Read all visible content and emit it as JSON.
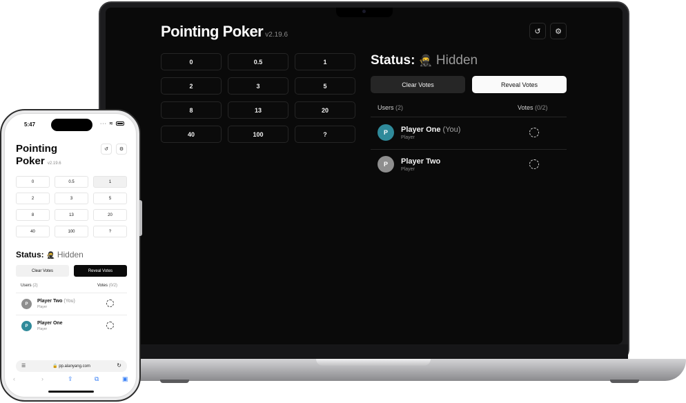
{
  "colors": {
    "avatar_teal": "#2f8a9a",
    "avatar_gray": "#8e8e8e"
  },
  "app": {
    "title": "Pointing Poker",
    "title_line1": "Pointing",
    "title_line2": "Poker",
    "version": "v2.19.6",
    "cards": [
      "0",
      "0.5",
      "1",
      "2",
      "3",
      "5",
      "8",
      "13",
      "20",
      "40",
      "100",
      "?"
    ],
    "status_label": "Status:",
    "status_emoji": "🥷",
    "status_value": "Hidden",
    "clear_votes": "Clear Votes",
    "reveal_votes": "Reveal Votes",
    "users_label": "Users",
    "users_count": "(2)",
    "votes_label": "Votes",
    "votes_count": "(0/2)",
    "history_icon": "history-icon",
    "settings_icon": "gear-icon"
  },
  "laptop_users": [
    {
      "initial": "P",
      "name": "Player One",
      "you": "(You)",
      "role": "Player",
      "avatar_color": "teal"
    },
    {
      "initial": "P",
      "name": "Player Two",
      "you": "",
      "role": "Player",
      "avatar_color": "gray"
    }
  ],
  "phone": {
    "time": "5:47",
    "selected_card": "1",
    "url": "pp.alanyang.com",
    "users": [
      {
        "initial": "P",
        "name": "Player Two",
        "you": "(You)",
        "role": "Player",
        "avatar_color": "gray"
      },
      {
        "initial": "P",
        "name": "Player One",
        "you": "",
        "role": "Player",
        "avatar_color": "teal"
      }
    ]
  }
}
